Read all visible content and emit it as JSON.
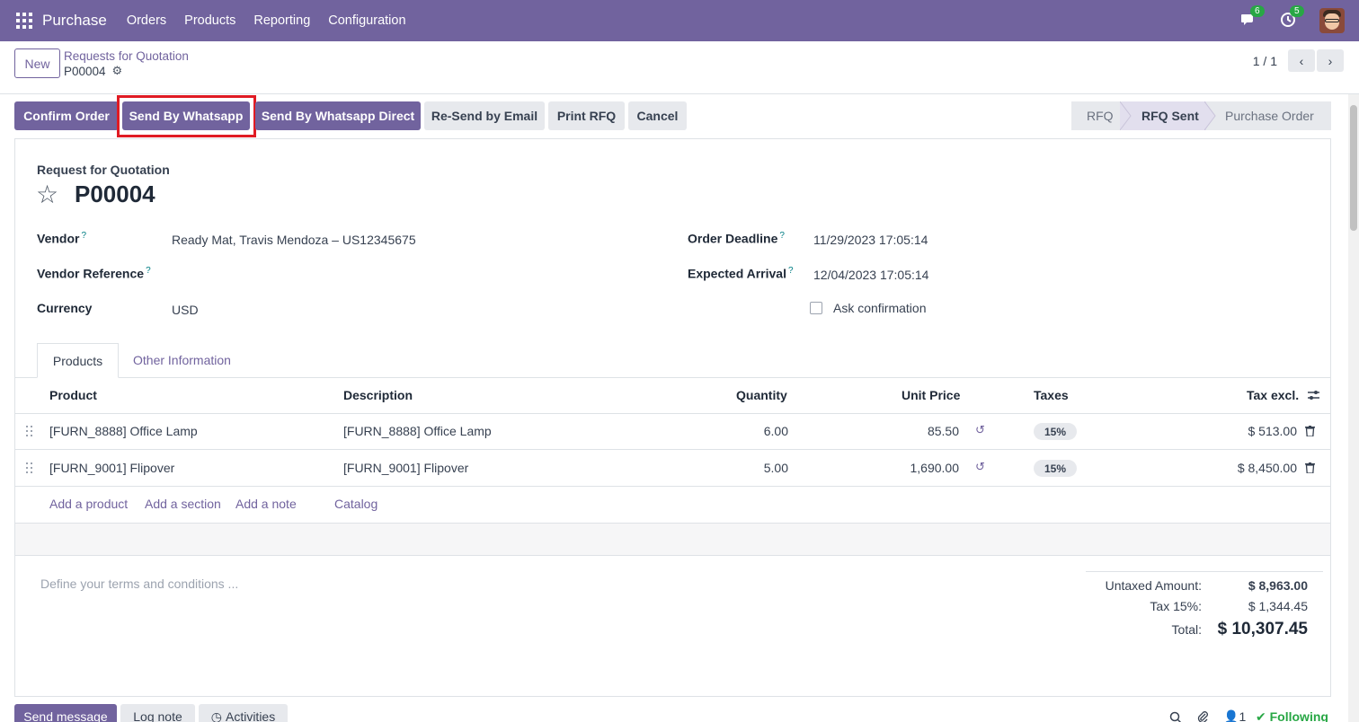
{
  "navbar": {
    "app_name": "Purchase",
    "menu": [
      "Orders",
      "Products",
      "Reporting",
      "Configuration"
    ],
    "messages_count": "6",
    "activities_count": "5",
    "bg_color": "#71639e"
  },
  "control": {
    "new_label": "New",
    "breadcrumb_parent": "Requests for Quotation",
    "breadcrumb_current": "P00004",
    "pager": "1 / 1"
  },
  "statusbar": {
    "buttons": [
      "Confirm Order",
      "Send By Whatsapp",
      "Send By Whatsapp Direct",
      "Re-Send by Email",
      "Print RFQ",
      "Cancel"
    ],
    "stages": [
      "RFQ",
      "RFQ Sent",
      "Purchase Order"
    ],
    "active_stage": "RFQ Sent"
  },
  "form": {
    "doc_label": "Request for Quotation",
    "title": "P00004",
    "vendor_label": "Vendor",
    "vendor_value": "Ready Mat, Travis Mendoza – US12345675",
    "vendor_ref_label": "Vendor Reference",
    "currency_label": "Currency",
    "currency_value": "USD",
    "deadline_label": "Order Deadline",
    "deadline_value": "11/29/2023 17:05:14",
    "arrival_label": "Expected Arrival",
    "arrival_value": "12/04/2023 17:05:14",
    "ask_confirmation_label": "Ask confirmation",
    "help_mark": "?"
  },
  "tabs": [
    "Products",
    "Other Information"
  ],
  "table": {
    "headers": [
      "Product",
      "Description",
      "Quantity",
      "Unit Price",
      "Taxes",
      "Tax excl."
    ],
    "rows": [
      {
        "product": "[FURN_8888] Office Lamp",
        "description": "[FURN_8888] Office Lamp",
        "quantity": "6.00",
        "unit_price": "85.50",
        "taxes": "15%",
        "subtotal": "$ 513.00"
      },
      {
        "product": "[FURN_9001] Flipover",
        "description": "[FURN_9001] Flipover",
        "quantity": "5.00",
        "unit_price": "1,690.00",
        "taxes": "15%",
        "subtotal": "$ 8,450.00"
      }
    ],
    "add_links": [
      "Add a product",
      "Add a section",
      "Add a note",
      "Catalog"
    ]
  },
  "terms_placeholder": "Define your terms and conditions ...",
  "totals": {
    "untaxed_label": "Untaxed Amount:",
    "untaxed_value": "$ 8,963.00",
    "tax_label": "Tax 15%:",
    "tax_value": "$ 1,344.45",
    "total_label": "Total:",
    "total_value": "$ 10,307.45"
  },
  "chatter": {
    "send_message": "Send message",
    "log_note": "Log note",
    "activities": "Activities",
    "followers_count": "1",
    "following": "Following"
  }
}
